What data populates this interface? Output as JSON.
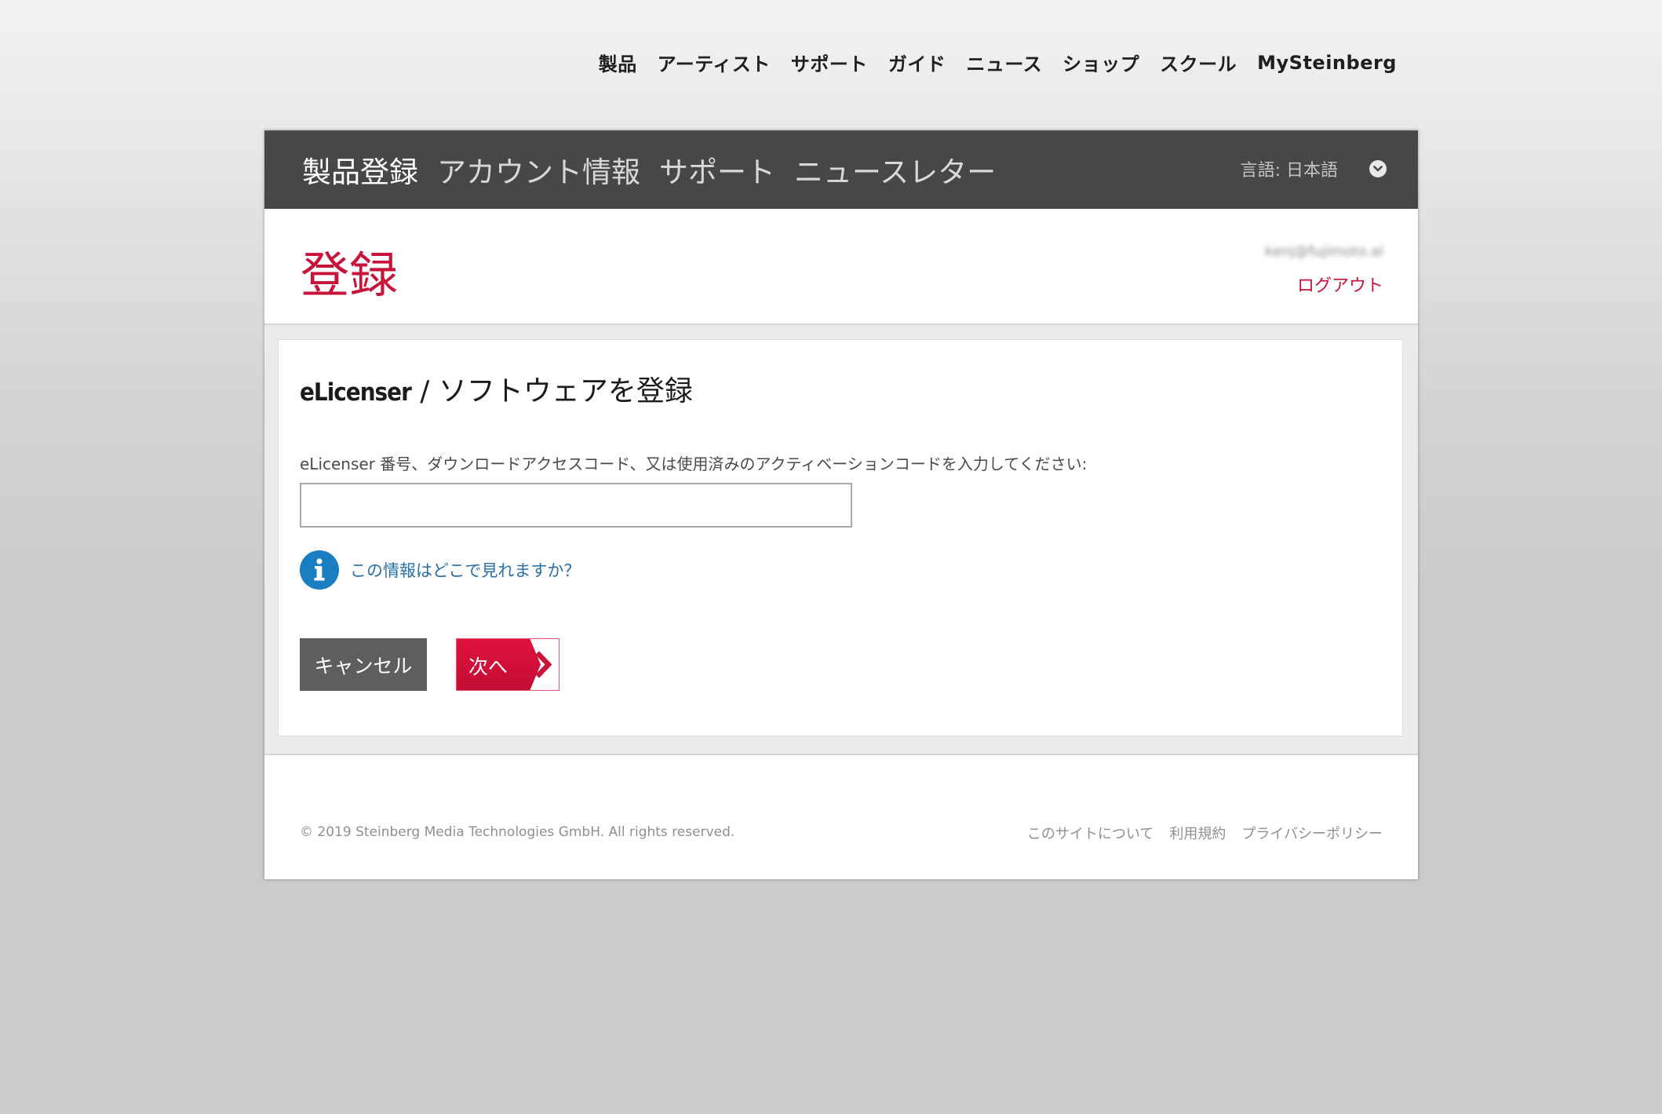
{
  "colors": {
    "brand_red": "#c8133a",
    "account_bar": "#474747",
    "info_blue": "#1a7ec3",
    "link_blue": "#2a6fa8",
    "cancel_gray": "#5e5e5e"
  },
  "site_nav": {
    "items": [
      {
        "label": "製品"
      },
      {
        "label": "アーティスト"
      },
      {
        "label": "サポート"
      },
      {
        "label": "ガイド"
      },
      {
        "label": "ニュース"
      },
      {
        "label": "ショップ"
      },
      {
        "label": "スクール"
      },
      {
        "label": "MySteinberg"
      }
    ]
  },
  "account_bar": {
    "tabs": [
      {
        "label": "製品登録",
        "active": true
      },
      {
        "label": "アカウント情報",
        "active": false
      },
      {
        "label": "サポート",
        "active": false
      },
      {
        "label": "ニュースレター",
        "active": false
      }
    ],
    "language_label": "言語: 日本語",
    "language_icon": "chevron-down-circle-icon"
  },
  "header": {
    "title": "登録",
    "user_email": "kenj@fujimoto.al",
    "logout_label": "ログアウト"
  },
  "form": {
    "title_brand": "eLicenser",
    "title_rest": " / ソフトウェアを登録",
    "field_label": "eLicenser 番号、ダウンロードアクセスコード、又は使用済みのアクティベーションコードを入力してください:",
    "field_value": "",
    "field_placeholder": "",
    "info_icon": "info-icon",
    "info_link_label": "この情報はどこで見れますか？",
    "cancel_label": "キャンセル",
    "next_label": "次へ",
    "next_icon": "chevron-right-icon"
  },
  "footer": {
    "copyright": "© 2019 Steinberg Media Technologies GmbH. All rights reserved.",
    "links": [
      {
        "label": "このサイトについて"
      },
      {
        "label": "利用規約"
      },
      {
        "label": "プライバシーポリシー"
      }
    ]
  }
}
